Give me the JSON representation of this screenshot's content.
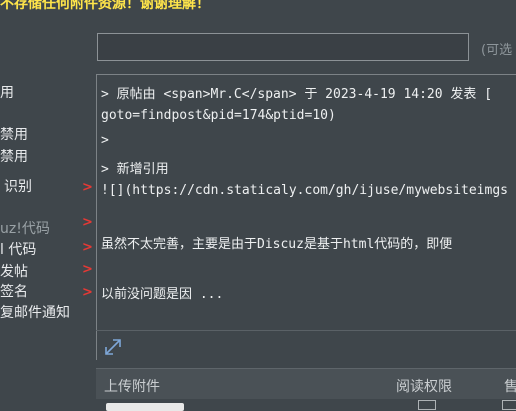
{
  "banner": {
    "text": "不存储任何附件资源！谢谢理解！"
  },
  "subject": {
    "value": "",
    "hint": "(可选"
  },
  "options": [
    {
      "label": "用",
      "dim": false
    },
    {
      "label": "禁用",
      "dim": false
    },
    {
      "label": "禁用",
      "dim": false
    },
    {
      "label": "识别",
      "dim": false
    },
    {
      "label": "uz!代码",
      "dim": true
    },
    {
      "label": "l 代码",
      "dim": false
    },
    {
      "label": "发帖",
      "dim": false
    },
    {
      "label": "签名",
      "dim": false
    },
    {
      "label": "复邮件通知",
      "dim": false
    }
  ],
  "editor": {
    "lines": [
      "> 原帖由 <span>Mr.C</span> 于 2023-4-19 14:20 发表 [",
      "goto=findpost&pid=174&ptid=10)",
      ">",
      "> 新增引用",
      "![](https://cdn.staticaly.com/gh/ijuse/mywebsiteimgs",
      "",
      "虽然不太完善，主要是由于Discuz是基于html代码的，即便",
      "",
      "以前没问题是因 ..."
    ]
  },
  "attachments": {
    "header_upload": "上传附件",
    "header_read_permission": "阅读权限",
    "header_price": "售"
  },
  "icons": {
    "expand": "resize-icon",
    "chevron": "chevron-right-icon"
  },
  "colors": {
    "background": "#3f464b",
    "banner": "#ffe54a",
    "chevron": "#e53935"
  }
}
